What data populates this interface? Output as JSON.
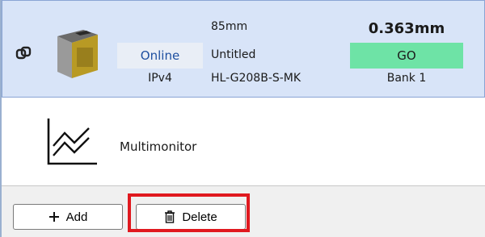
{
  "device": {
    "distance": "85mm",
    "status": "Online",
    "name": "Untitled",
    "protocol": "IPv4",
    "model": "HL-G208B-S-MK",
    "measurement": "0.363mm",
    "judgement": "GO",
    "bank": "Bank 1",
    "colors": {
      "row_bg": "#d8e4f8",
      "go": "#6ee3a6",
      "status_text": "#1e4fa0"
    },
    "icons": [
      "link-icon",
      "sensor-icon"
    ]
  },
  "multimonitor": {
    "label": "Multimonitor",
    "icon": "line-chart-icon"
  },
  "toolbar": {
    "add_label": "Add",
    "delete_label": "Delete",
    "add_icon": "plus-icon",
    "delete_icon": "trash-icon",
    "highlight_color": "#e0191f"
  }
}
